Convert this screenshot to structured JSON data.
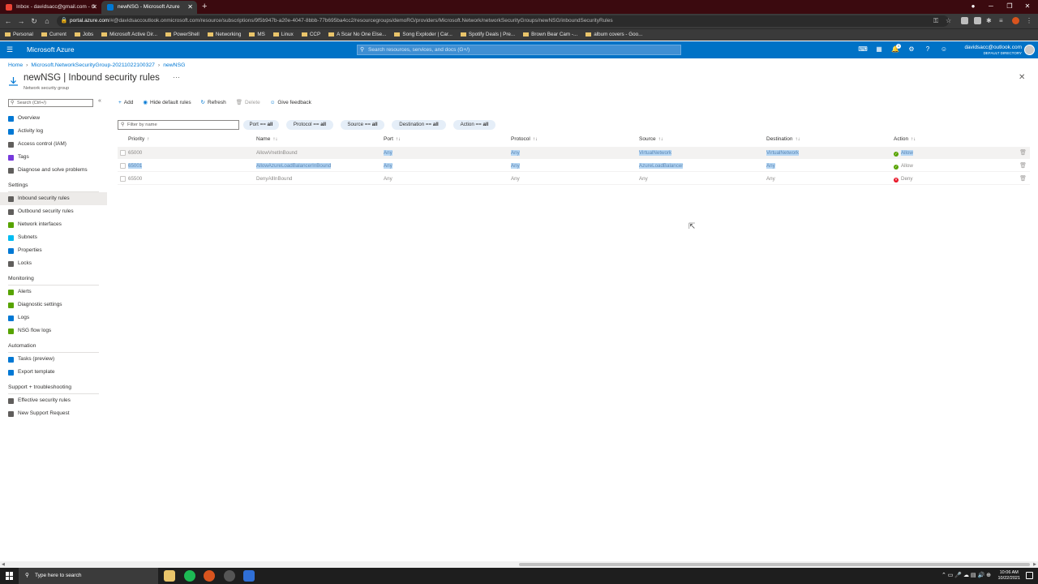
{
  "browser": {
    "tabs": [
      {
        "title": "Inbox - davidsacc@gmail.com - G",
        "favicon_color": "#ea4335"
      },
      {
        "title": "newNSG - Microsoft Azure",
        "favicon_color": "#0078d4"
      }
    ],
    "url_host": "portal.azure.com",
    "url_rest": "/#@davidsaccoutlook.onmicrosoft.com/resource/subscriptions/9f5b947b-a20e-4047-8bbb-77b695ba4cc2/resourcegroups/demoRG/providers/Microsoft.Network/networkSecurityGroups/newNSG/inboundSecurityRules",
    "bookmarks": [
      "Personal",
      "Current",
      "Jobs",
      "Microsoft Active Dir...",
      "PowerShell",
      "Networking",
      "MS",
      "Linux",
      "CCP",
      "A Scar No One Else...",
      "Song Exploder | Car...",
      "Spotify Deals | Pre...",
      "Brown Bear Cam -...",
      "album covers - Goo..."
    ]
  },
  "azure": {
    "brand": "Microsoft Azure",
    "search_placeholder": "Search resources, services, and docs (G+/)",
    "notification_count": "1",
    "account_email": "davidsacc@outlook.com",
    "account_directory": "DEFAULT DIRECTORY"
  },
  "breadcrumb": [
    "Home",
    "Microsoft.NetworkSecurityGroup-20211022100327",
    "newNSG"
  ],
  "page": {
    "title": "newNSG | Inbound security rules",
    "subtitle": "Network security group",
    "ellipsis": "···"
  },
  "nav": {
    "search_placeholder": "Search (Ctrl+/)",
    "top_items": [
      {
        "label": "Overview",
        "color": "#0078d4"
      },
      {
        "label": "Activity log",
        "color": "#0078d4"
      },
      {
        "label": "Access control (IAM)",
        "color": "#605e5c"
      },
      {
        "label": "Tags",
        "color": "#773adc"
      },
      {
        "label": "Diagnose and solve problems",
        "color": "#605e5c"
      }
    ],
    "sections": [
      {
        "title": "Settings",
        "items": [
          {
            "label": "Inbound security rules",
            "color": "#605e5c",
            "selected": true
          },
          {
            "label": "Outbound security rules",
            "color": "#605e5c"
          },
          {
            "label": "Network interfaces",
            "color": "#57a300"
          },
          {
            "label": "Subnets",
            "color": "#00bcf2"
          },
          {
            "label": "Properties",
            "color": "#0078d4"
          },
          {
            "label": "Locks",
            "color": "#605e5c"
          }
        ]
      },
      {
        "title": "Monitoring",
        "items": [
          {
            "label": "Alerts",
            "color": "#57a300"
          },
          {
            "label": "Diagnostic settings",
            "color": "#57a300"
          },
          {
            "label": "Logs",
            "color": "#0078d4"
          },
          {
            "label": "NSG flow logs",
            "color": "#57a300"
          }
        ]
      },
      {
        "title": "Automation",
        "items": [
          {
            "label": "Tasks (preview)",
            "color": "#0078d4"
          },
          {
            "label": "Export template",
            "color": "#0078d4"
          }
        ]
      },
      {
        "title": "Support + troubleshooting",
        "items": [
          {
            "label": "Effective security rules",
            "color": "#605e5c"
          },
          {
            "label": "New Support Request",
            "color": "#605e5c"
          }
        ]
      }
    ]
  },
  "toolbar": {
    "add": "Add",
    "hide_default": "Hide default rules",
    "refresh": "Refresh",
    "delete": "Delete",
    "feedback": "Give feedback"
  },
  "filters": {
    "placeholder": "Filter by name",
    "pills": [
      {
        "key": "Port",
        "value": "all"
      },
      {
        "key": "Protocol",
        "value": "all"
      },
      {
        "key": "Source",
        "value": "all"
      },
      {
        "key": "Destination",
        "value": "all"
      },
      {
        "key": "Action",
        "value": "all"
      }
    ]
  },
  "table": {
    "headers": [
      "Priority",
      "Name",
      "Port",
      "Protocol",
      "Source",
      "Destination",
      "Action"
    ],
    "rows": [
      {
        "priority": "65000",
        "name": "AllowVnetInBound",
        "port": "Any",
        "protocol": "Any",
        "source": "VirtualNetwork",
        "destination": "VirtualNetwork",
        "action": "Allow"
      },
      {
        "priority": "65001",
        "name": "AllowAzureLoadBalancerInBound",
        "port": "Any",
        "protocol": "Any",
        "source": "AzureLoadBalancer",
        "destination": "Any",
        "action": "Allow"
      },
      {
        "priority": "65500",
        "name": "DenyAllInBound",
        "port": "Any",
        "protocol": "Any",
        "source": "Any",
        "destination": "Any",
        "action": "Deny"
      }
    ]
  },
  "taskbar": {
    "search_placeholder": "Type here to search",
    "time": "10:06 AM",
    "date": "10/22/2021"
  }
}
